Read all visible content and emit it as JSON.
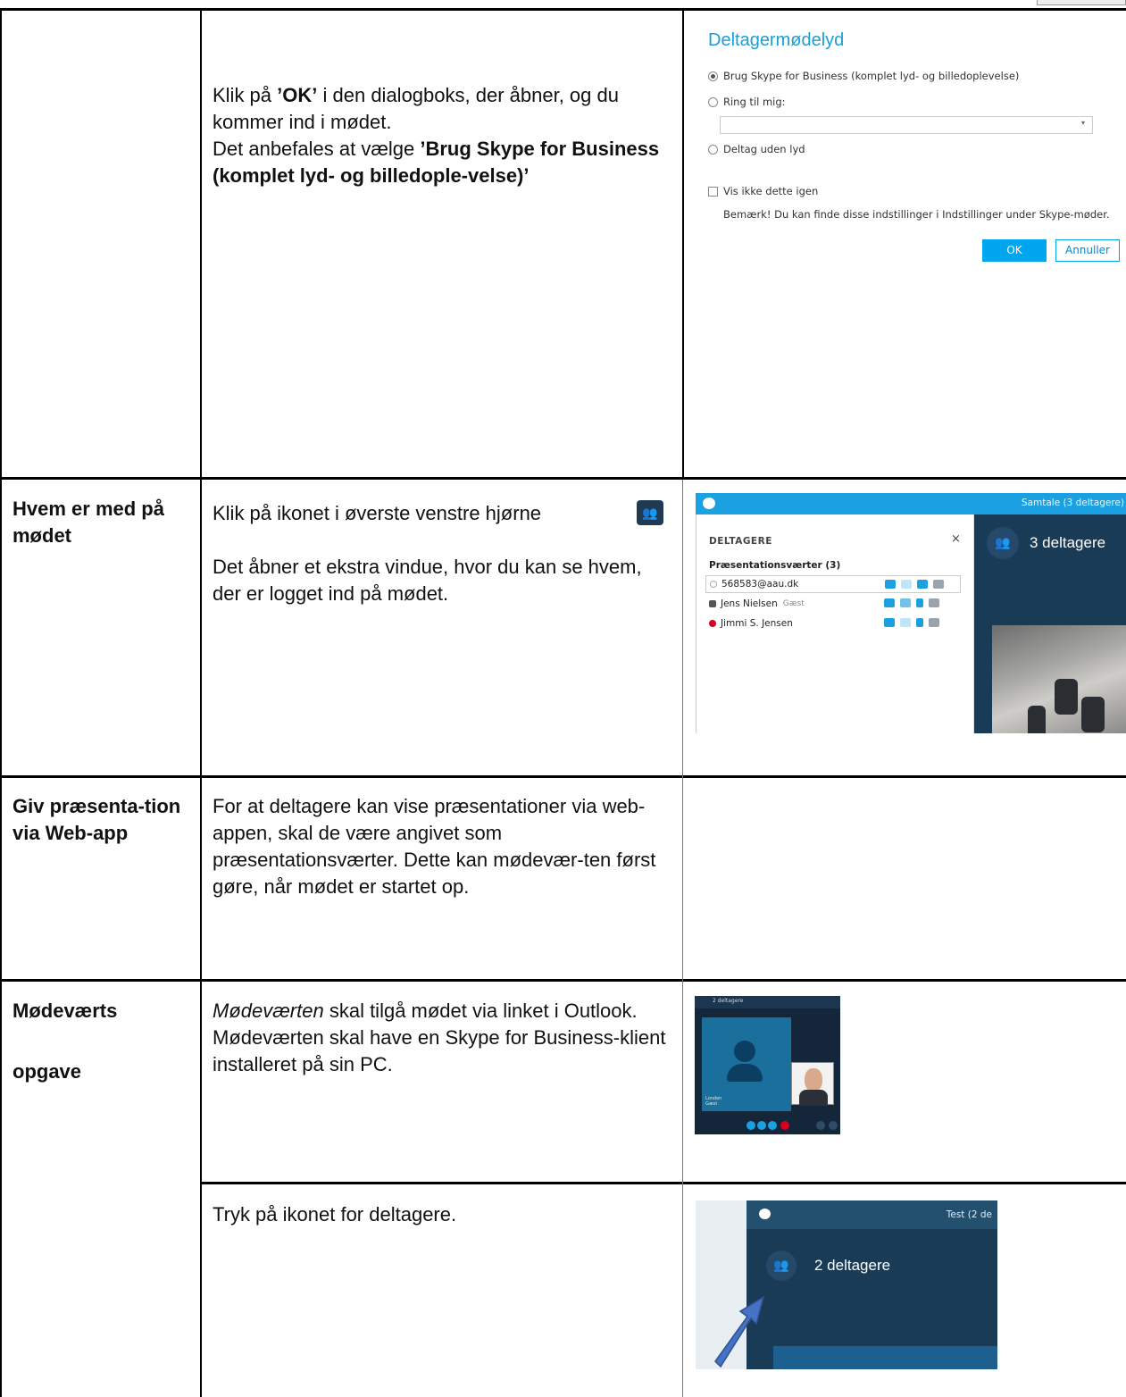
{
  "rows": [
    {
      "label": "",
      "text_parts": [
        {
          "t": "Klik på ",
          "b": false
        },
        {
          "t": "’OK’",
          "b": true
        },
        {
          "t": " i den dialogboks, der åbner, og du kommer ind i mødet.",
          "b": false
        }
      ],
      "text2_parts": [
        {
          "t": "Det anbefales at vælge ",
          "b": false
        },
        {
          "t": "’Brug Skype for Business (komplet lyd- og billedople-velse)’",
          "b": true
        }
      ]
    },
    {
      "label": "Hvem er med på mødet",
      "text1": "Klik på ikonet i øverste venstre hjørne",
      "text2": "Det åbner et ekstra vindue, hvor du kan se hvem, der er logget ind på mødet."
    },
    {
      "label": "Giv præsenta-tion via Web-app",
      "text1": "For at deltagere kan vise præsentationer via web-appen, skal de være angivet som præsentationsværter. Dette kan mødevær-ten først gøre, når mødet er startet op."
    },
    {
      "label_line1": "Mødeværts",
      "label_line2": "opgave",
      "text_italic": "Mødeværten",
      "text_rest": " skal tilgå mødet via linket i Outlook. Mødeværten skal have en Skype for Business-klient installeret på sin PC."
    },
    {
      "text1": "Tryk på ikonet for deltagere."
    }
  ],
  "dialog": {
    "title": "Deltagermødelyd",
    "option1": "Brug Skype for Business (komplet lyd- og billedoplevelse)",
    "option2": "Ring til mig:",
    "option3": "Deltag uden lyd",
    "checkbox": "Vis ikke dette igen",
    "note": "Bemærk! Du kan finde disse indstillinger i Indstillinger under Skype-møder.",
    "ok": "OK",
    "cancel": "Annuller"
  },
  "conversation": {
    "title": "Samtale (3 deltagere)",
    "panel_heading": "DELTAGERE",
    "close": "×",
    "group": "Præsentationsværter (3)",
    "participants": [
      {
        "name": "568583@aau.dk",
        "tag": ""
      },
      {
        "name": "Jens Nielsen",
        "tag": "Gæst"
      },
      {
        "name": "Jimmi S. Jensen",
        "tag": ""
      }
    ],
    "count_label": "3 deltagere"
  },
  "small_meeting": {
    "title": "2 deltagere",
    "tile_name": "Londen\nGæst"
  },
  "test_window": {
    "title": "Test (2 de",
    "count_label": "2 deltagere"
  },
  "colors": {
    "skype_blue": "#1ba1e2",
    "dark_navy": "#1a3b56",
    "ok_button": "#00a6ed"
  }
}
